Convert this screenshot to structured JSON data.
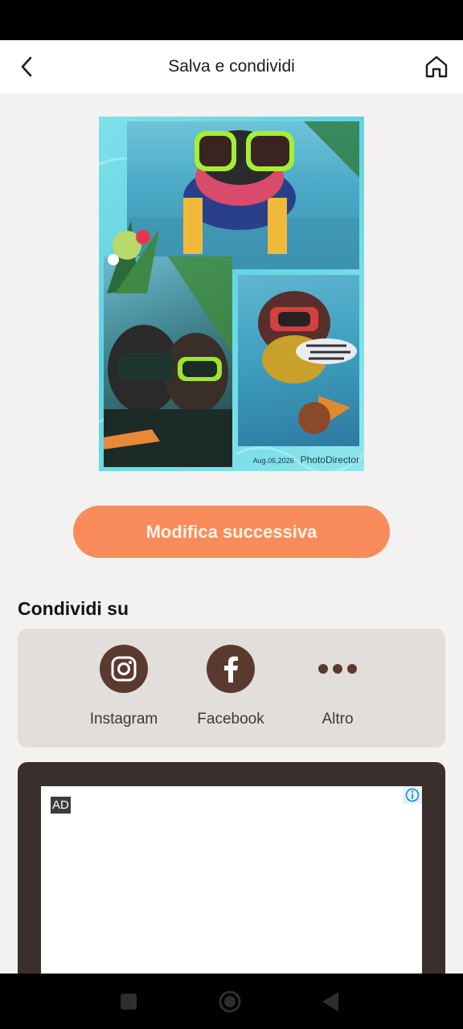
{
  "header": {
    "title": "Salva e condividi",
    "back_icon": "chevron-left-icon",
    "home_icon": "home-icon"
  },
  "preview": {
    "date": "Aug.06,2026",
    "brand": "PhotoDirector"
  },
  "primary_action": {
    "label": "Modifica successiva",
    "color": "#f98c5a"
  },
  "share": {
    "title": "Condividi su",
    "items": [
      {
        "label": "Instagram",
        "icon": "instagram-icon"
      },
      {
        "label": "Facebook",
        "icon": "facebook-icon"
      },
      {
        "label": "Altro",
        "icon": "more-dots-icon"
      }
    ],
    "icon_color": "#5a3a2f"
  },
  "ad": {
    "badge": "AD",
    "info_icon": "info-icon"
  },
  "nav": {
    "icons": [
      "square-icon",
      "circle-icon",
      "triangle-back-icon"
    ]
  }
}
